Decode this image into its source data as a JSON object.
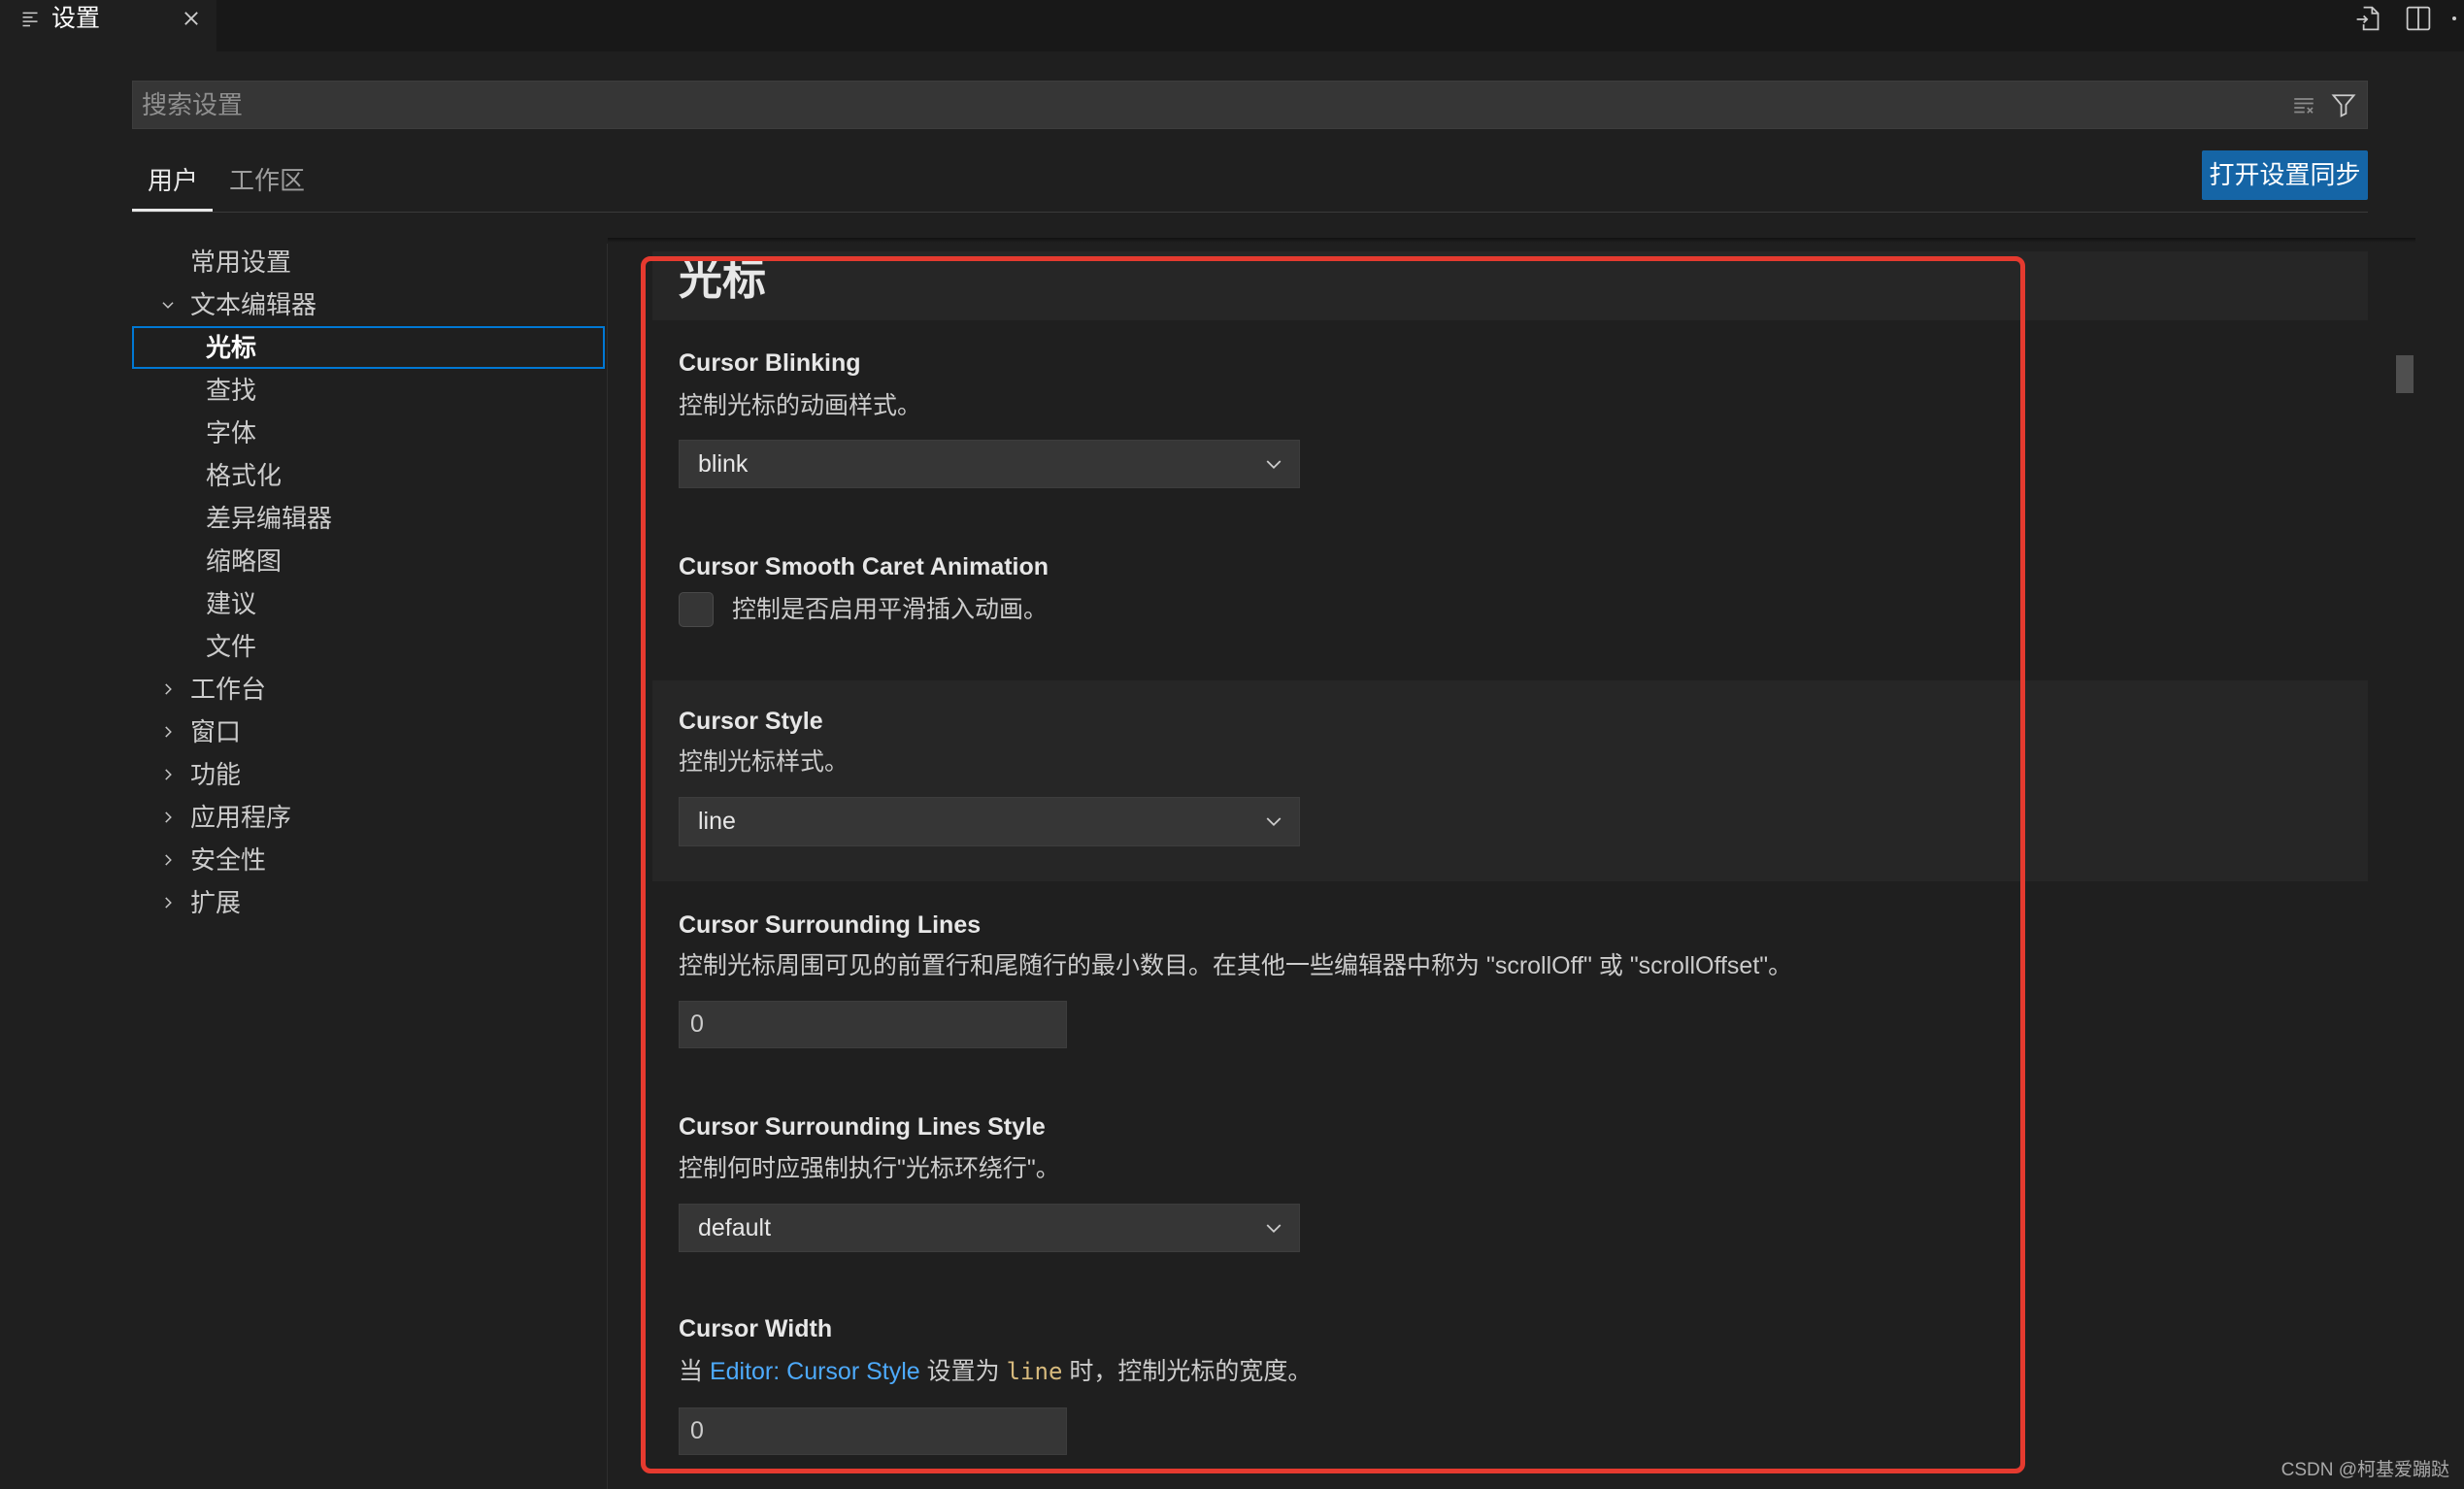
{
  "tab": {
    "title": "设置",
    "icon": "settings-editor-icon",
    "close_icon": "close-icon"
  },
  "title_actions": [
    "open-settings-json-icon",
    "split-editor-icon",
    "more-actions-icon"
  ],
  "search": {
    "placeholder": "搜索设置",
    "actions": [
      "clear-filter-icon",
      "filter-icon"
    ]
  },
  "scope_tabs": [
    {
      "label": "用户",
      "active": true
    },
    {
      "label": "工作区",
      "active": false
    }
  ],
  "sync_button": {
    "label": "打开设置同步"
  },
  "toc": [
    {
      "label": "常用设置"
    },
    {
      "label": "文本编辑器",
      "expanded": true,
      "children": [
        {
          "label": "光标",
          "selected": true
        },
        {
          "label": "查找"
        },
        {
          "label": "字体"
        },
        {
          "label": "格式化"
        },
        {
          "label": "差异编辑器"
        },
        {
          "label": "缩略图"
        },
        {
          "label": "建议"
        },
        {
          "label": "文件"
        }
      ]
    },
    {
      "label": "工作台",
      "expanded": false
    },
    {
      "label": "窗口",
      "expanded": false
    },
    {
      "label": "功能",
      "expanded": false
    },
    {
      "label": "应用程序",
      "expanded": false
    },
    {
      "label": "安全性",
      "expanded": false
    },
    {
      "label": "扩展",
      "expanded": false
    }
  ],
  "section": {
    "title": "光标"
  },
  "settings": [
    {
      "title": "Cursor Blinking",
      "description": "控制光标的动画样式。",
      "value": "blink"
    },
    {
      "title": "Cursor Smooth Caret Animation",
      "description": "控制是否启用平滑插入动画。",
      "checked": false
    },
    {
      "title": "Cursor Style",
      "description": "控制光标样式。",
      "value": "line",
      "hovered": true
    },
    {
      "title": "Cursor Surrounding Lines",
      "description": "控制光标周围可见的前置行和尾随行的最小数目。在其他一些编辑器中称为 \"scrollOff\" 或 \"scrollOffset\"。",
      "value": "0"
    },
    {
      "title": "Cursor Surrounding Lines Style",
      "description": "控制何时应强制执行\"光标环绕行\"。",
      "value": "default"
    },
    {
      "title": "Cursor Width",
      "description": {
        "prefix": "当 ",
        "link": "Editor: Cursor Style",
        "middle": " 设置为 ",
        "code": "line",
        "suffix": " 时，控制光标的宽度。"
      },
      "value": "0"
    }
  ],
  "watermark": "CSDN @柯基爱蹦跶",
  "colors": {
    "background": "#1f1f1f",
    "accent": "#0078d4",
    "button": "#1565a6",
    "link": "#4daafc",
    "code": "#d7ba7d",
    "annotation": "#e53a2f"
  }
}
